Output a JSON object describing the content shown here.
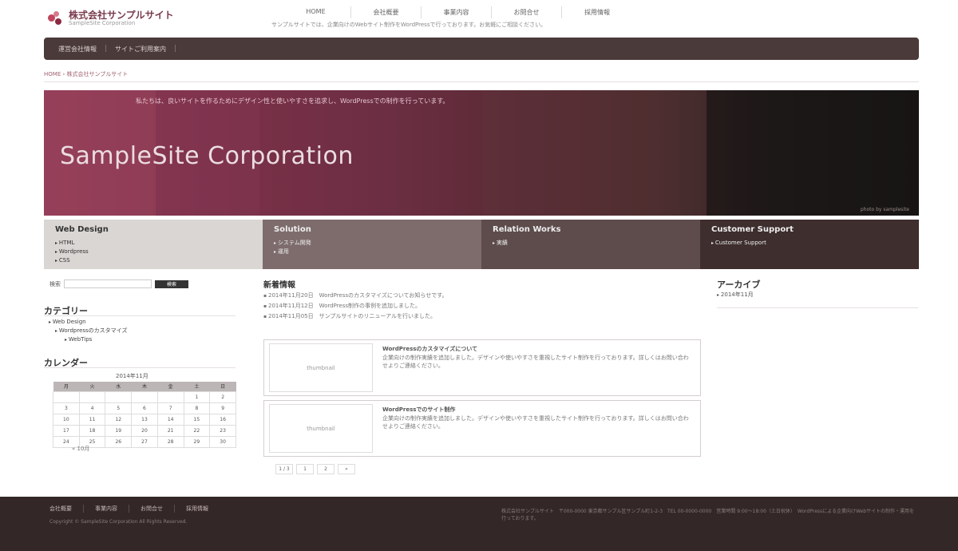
{
  "logo": {
    "title": "株式会社サンプルサイト",
    "subtitle": "SampleSite Corporation"
  },
  "nav": [
    "HOME",
    "会社概要",
    "事業内容",
    "お問合せ",
    "採用情報"
  ],
  "tagline": "サンプルサイトでは、企業向けのWebサイト制作をWordPressで行っております。お気軽にご相談ください。",
  "topbar": {
    "items": [
      "運営会社情報",
      "サイトご利用案内"
    ]
  },
  "breadcrumb": "HOME › 株式会社サンプルサイト",
  "hero": {
    "top_text": "私たちは、良いサイトを作るためにデザイン性と使いやすさを追求し、WordPressでの制作を行っています。",
    "title": "SampleSite  Corporation",
    "credit": "photo by samplesite"
  },
  "services": [
    {
      "title": "Web Design",
      "items": [
        "HTML",
        "Wordpress",
        "CSS"
      ]
    },
    {
      "title": "Solution",
      "items": [
        "システム開発",
        "運用"
      ]
    },
    {
      "title": "Relation Works",
      "items": [
        "実績"
      ]
    },
    {
      "title": "Customer Support",
      "items": [
        "Customer Support"
      ]
    }
  ],
  "search": {
    "label": "検索",
    "button": "検索"
  },
  "categories": {
    "heading": "カテゴリー",
    "items": [
      "Web Design",
      "Wordpressのカスタマイズ",
      "WebTips"
    ]
  },
  "calendar": {
    "heading": "カレンダー",
    "caption": "2014年11月",
    "weekdays": [
      "月",
      "火",
      "水",
      "木",
      "金",
      "土",
      "日"
    ],
    "rows": [
      [
        "",
        "",
        "",
        "",
        "",
        "1",
        "2"
      ],
      [
        "3",
        "4",
        "5",
        "6",
        "7",
        "8",
        "9"
      ],
      [
        "10",
        "11",
        "12",
        "13",
        "14",
        "15",
        "16"
      ],
      [
        "17",
        "18",
        "19",
        "20",
        "21",
        "22",
        "23"
      ],
      [
        "24",
        "25",
        "26",
        "27",
        "28",
        "29",
        "30"
      ]
    ],
    "prev": "« 10月"
  },
  "main": {
    "heading": "新着情報",
    "news": [
      "2014年11月20日　WordPressのカスタマイズについてお知らせです。",
      "2014年11月12日　WordPress制作の事例を追加しました。",
      "2014年11月05日　サンプルサイトのリニューアルを行いました。"
    ],
    "cards": [
      {
        "thumb": "thumbnail",
        "title": "WordPressのカスタマイズについて",
        "body": "企業向けの制作実績を追加しました。デザインや使いやすさを重視したサイト制作を行っております。詳しくはお問い合わせよりご連絡ください。"
      },
      {
        "thumb": "thumbnail",
        "title": "WordPressでのサイト制作",
        "body": "企業向けの制作実績を追加しました。デザインや使いやすさを重視したサイト制作を行っております。詳しくはお問い合わせよりご連絡ください。"
      }
    ],
    "pager": [
      "1 / 3",
      "1",
      "2",
      "»"
    ]
  },
  "archive": {
    "heading": "アーカイブ",
    "items": [
      "2014年11月"
    ]
  },
  "footer": {
    "nav": [
      "会社概要",
      "事業内容",
      "お問合せ",
      "採用情報"
    ],
    "copyright": "Copyright © SampleSite Corporation All Rights Reserved.",
    "info": "株式会社サンプルサイト　〒000-0000 東京都サンプル区サンプル町1-2-3　TEL 00-0000-0000　営業時間 9:00〜18:00（土日祝休）　WordPressによる企業向けWebサイトの制作・運用を行っております。"
  },
  "colors": {
    "accent": "#7a3b4d",
    "topbar": "#4b3a3a",
    "footer": "#332827"
  }
}
